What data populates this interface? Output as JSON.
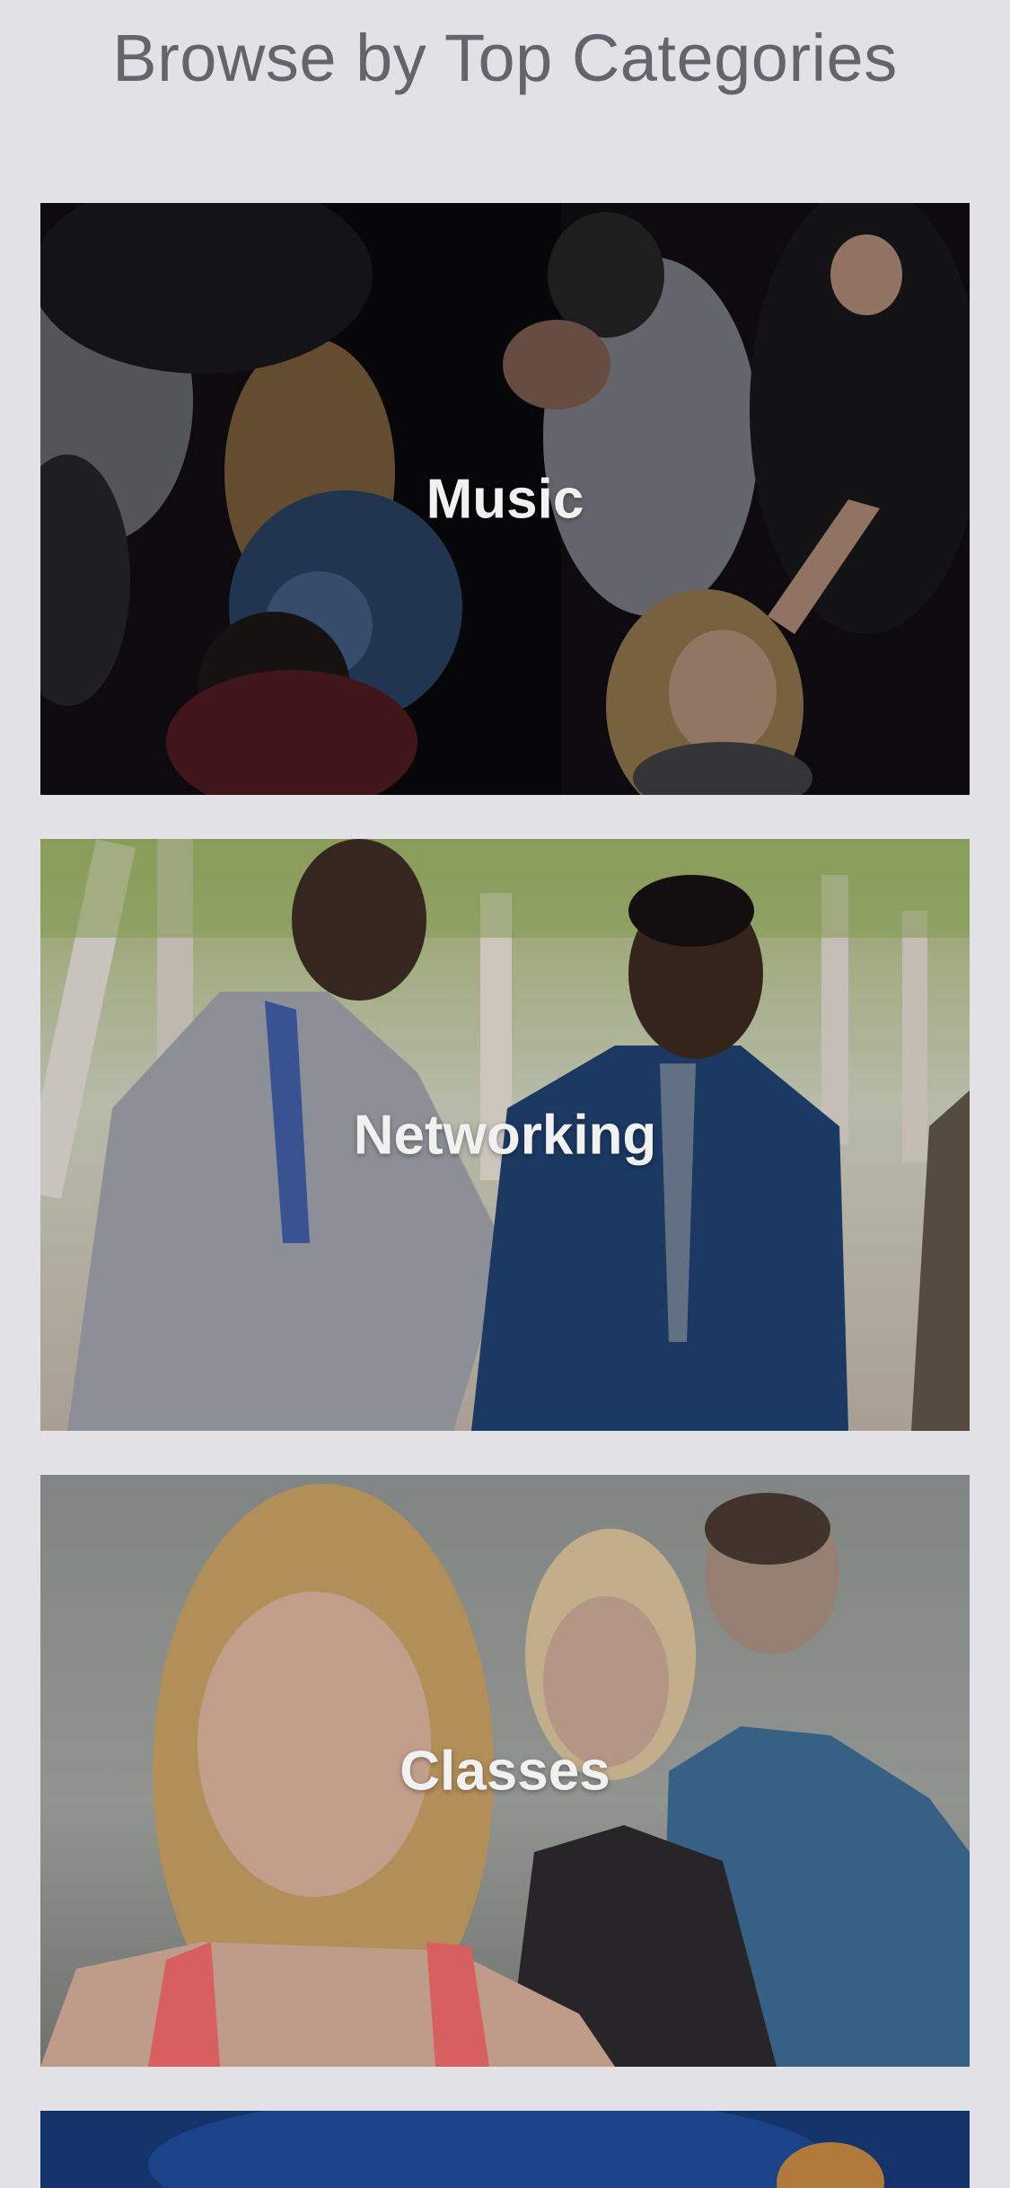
{
  "header": {
    "title": "Browse by Top Categories"
  },
  "categories": [
    {
      "label": "Music",
      "image": "crowd-at-party-photo"
    },
    {
      "label": "Networking",
      "image": "businessmen-in-suits-photo"
    },
    {
      "label": "Classes",
      "image": "yoga-class-photo"
    },
    {
      "label": "",
      "image": "performer-on-stage-photo"
    }
  ]
}
